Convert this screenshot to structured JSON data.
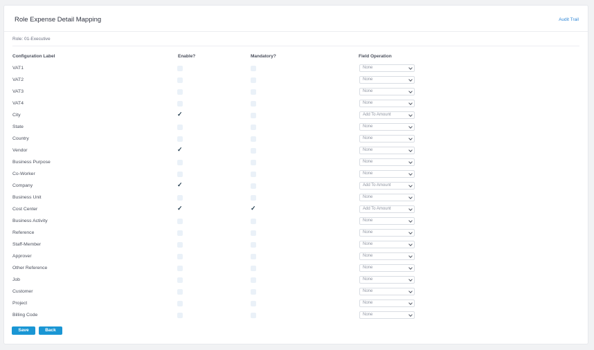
{
  "header": {
    "title": "Role Expense Detail Mapping",
    "audit_link": "Audit Trail"
  },
  "role_line": "Role: 01-Executive",
  "columns": {
    "label": "Configuration Label",
    "enable": "Enable?",
    "mandatory": "Mandatory?",
    "operation": "Field Operation"
  },
  "rows": [
    {
      "label": "VAT1",
      "enabled": false,
      "mandatory": false,
      "operation": "None"
    },
    {
      "label": "VAT2",
      "enabled": false,
      "mandatory": false,
      "operation": "None"
    },
    {
      "label": "VAT3",
      "enabled": false,
      "mandatory": false,
      "operation": "None"
    },
    {
      "label": "VAT4",
      "enabled": false,
      "mandatory": false,
      "operation": "None"
    },
    {
      "label": "City",
      "enabled": true,
      "mandatory": false,
      "operation": "Add To Amount"
    },
    {
      "label": "State",
      "enabled": false,
      "mandatory": false,
      "operation": "None"
    },
    {
      "label": "Country",
      "enabled": false,
      "mandatory": false,
      "operation": "None"
    },
    {
      "label": "Vendor",
      "enabled": true,
      "mandatory": false,
      "operation": "None"
    },
    {
      "label": "Business Purpose",
      "enabled": false,
      "mandatory": false,
      "operation": "None"
    },
    {
      "label": "Co-Worker",
      "enabled": false,
      "mandatory": false,
      "operation": "None"
    },
    {
      "label": "Company",
      "enabled": true,
      "mandatory": false,
      "operation": "Add To Amount"
    },
    {
      "label": "Business Unit",
      "enabled": false,
      "mandatory": false,
      "operation": "None"
    },
    {
      "label": "Cost Center",
      "enabled": true,
      "mandatory": true,
      "operation": "Add To Amount"
    },
    {
      "label": "Business Activity",
      "enabled": false,
      "mandatory": false,
      "operation": "None"
    },
    {
      "label": "Reference",
      "enabled": false,
      "mandatory": false,
      "operation": "None"
    },
    {
      "label": "Staff-Member",
      "enabled": false,
      "mandatory": false,
      "operation": "None"
    },
    {
      "label": "Approver",
      "enabled": false,
      "mandatory": false,
      "operation": "None"
    },
    {
      "label": "Other Reference",
      "enabled": false,
      "mandatory": false,
      "operation": "None"
    },
    {
      "label": "Job",
      "enabled": false,
      "mandatory": false,
      "operation": "None"
    },
    {
      "label": "Customer",
      "enabled": false,
      "mandatory": false,
      "operation": "None"
    },
    {
      "label": "Project",
      "enabled": false,
      "mandatory": false,
      "operation": "None"
    },
    {
      "label": "Billing Code",
      "enabled": false,
      "mandatory": false,
      "operation": "None"
    }
  ],
  "buttons": {
    "save": "Save",
    "back": "Back"
  },
  "icons": {
    "check": "check-icon",
    "dropdown": "chevron-down-icon"
  },
  "colors": {
    "accent": "#1a96d4",
    "link": "#2f86d6",
    "checkbox_bg": "#eaf1f8"
  }
}
